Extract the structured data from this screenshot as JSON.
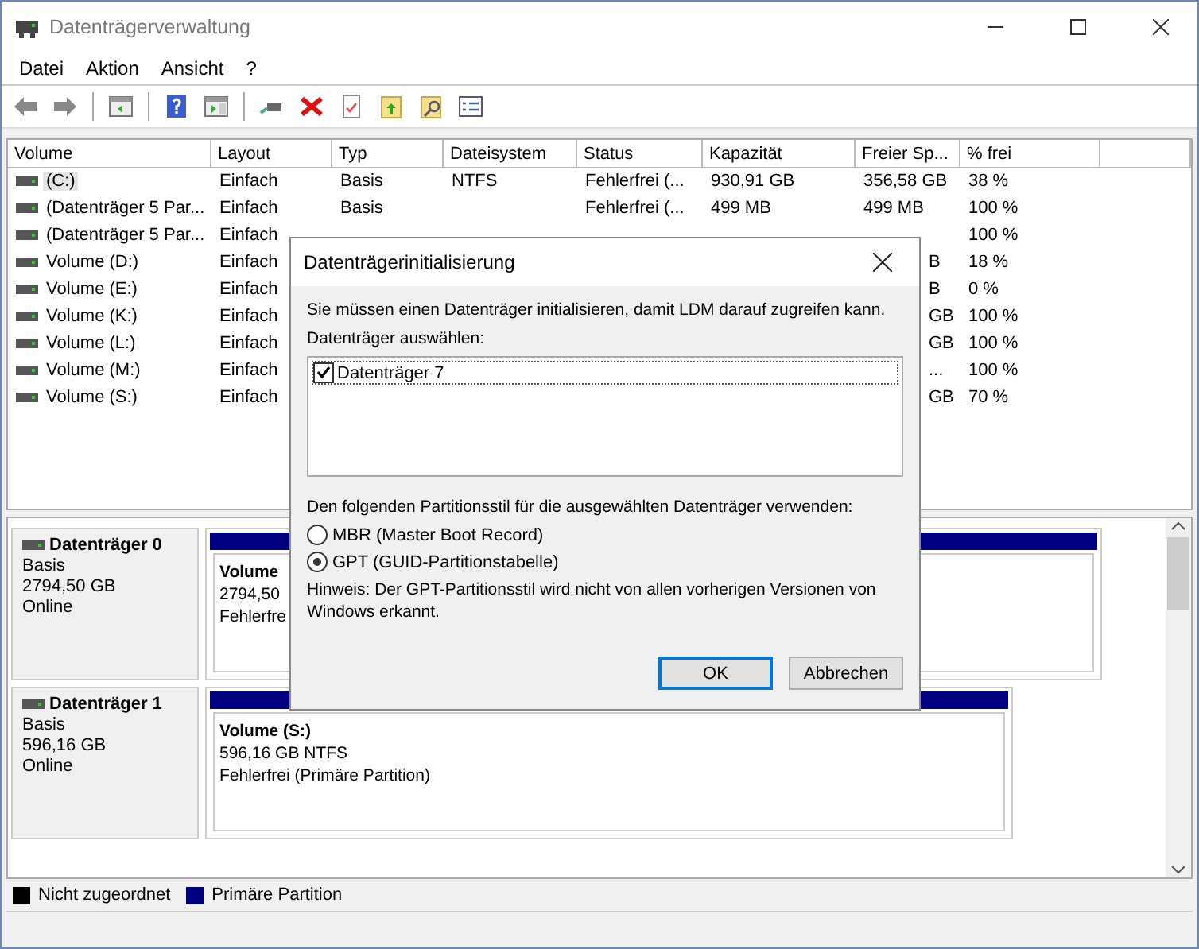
{
  "window": {
    "title": "Datenträgerverwaltung"
  },
  "menu": [
    "Datei",
    "Aktion",
    "Ansicht",
    "?"
  ],
  "table": {
    "columns": [
      "Volume",
      "Layout",
      "Typ",
      "Dateisystem",
      "Status",
      "Kapazität",
      "Freier Sp...",
      "% frei"
    ],
    "rows": [
      {
        "cells": [
          "(C:)",
          "Einfach",
          "Basis",
          "NTFS",
          "Fehlerfrei (...",
          "930,91 GB",
          "356,58 GB",
          "38 %"
        ],
        "selected": true
      },
      {
        "cells": [
          "(Datenträger 5 Par...",
          "Einfach",
          "Basis",
          null,
          "Fehlerfrei (...",
          "499 MB",
          "499 MB",
          "100 %"
        ],
        "selected": false
      },
      {
        "cells": [
          "(Datenträger 5 Par...",
          "Einfach",
          null,
          null,
          null,
          null,
          null,
          "100 %"
        ],
        "selected": false
      },
      {
        "cells": [
          "Volume (D:)",
          "Einfach",
          null,
          null,
          null,
          null,
          "B",
          "18 %"
        ],
        "selected": false
      },
      {
        "cells": [
          "Volume (E:)",
          "Einfach",
          null,
          null,
          null,
          null,
          "B",
          "0 %"
        ],
        "selected": false
      },
      {
        "cells": [
          "Volume (K:)",
          "Einfach",
          null,
          null,
          null,
          null,
          "GB",
          "100 %"
        ],
        "selected": false
      },
      {
        "cells": [
          "Volume (L:)",
          "Einfach",
          null,
          null,
          null,
          null,
          "GB",
          "100 %"
        ],
        "selected": false
      },
      {
        "cells": [
          "Volume (M:)",
          "Einfach",
          null,
          null,
          null,
          null,
          "...",
          "100 %"
        ],
        "selected": false
      },
      {
        "cells": [
          "Volume (S:)",
          "Einfach",
          null,
          null,
          null,
          null,
          "GB",
          "70 %"
        ],
        "selected": false
      }
    ]
  },
  "disks": [
    {
      "name": "Datenträger 0",
      "type": "Basis",
      "size": "2794,50 GB",
      "state": "Online",
      "partition": {
        "title": "Volume",
        "size": "2794,50",
        "status": "Fehlerfre"
      },
      "wide": true
    },
    {
      "name": "Datenträger 1",
      "type": "Basis",
      "size": "596,16 GB",
      "state": "Online",
      "partition": {
        "title": "Volume  (S:)",
        "size": "596,16 GB NTFS",
        "status": "Fehlerfrei (Primäre Partition)"
      },
      "wide": false
    }
  ],
  "legend": [
    {
      "label": "Nicht zugeordnet",
      "color": "#000000"
    },
    {
      "label": "Primäre Partition",
      "color": "#000080"
    }
  ],
  "dialog": {
    "title": "Datenträgerinitialisierung",
    "message": "Sie müssen einen Datenträger initialisieren, damit LDM darauf zugreifen kann.",
    "select_label": "Datenträger auswählen:",
    "disks": [
      {
        "label": "Datenträger 7",
        "checked": true
      }
    ],
    "style_label": "Den folgenden Partitionsstil für die ausgewählten Datenträger verwenden:",
    "options": [
      {
        "label": "MBR (Master Boot Record)",
        "selected": false
      },
      {
        "label": "GPT (GUID-Partitionstabelle)",
        "selected": true
      }
    ],
    "note": "Hinweis: Der GPT-Partitionsstil wird nicht von allen vorherigen Versionen von Windows erkannt.",
    "buttons": [
      {
        "label": "OK",
        "default": true
      },
      {
        "label": "Abbrechen",
        "default": false
      }
    ]
  }
}
